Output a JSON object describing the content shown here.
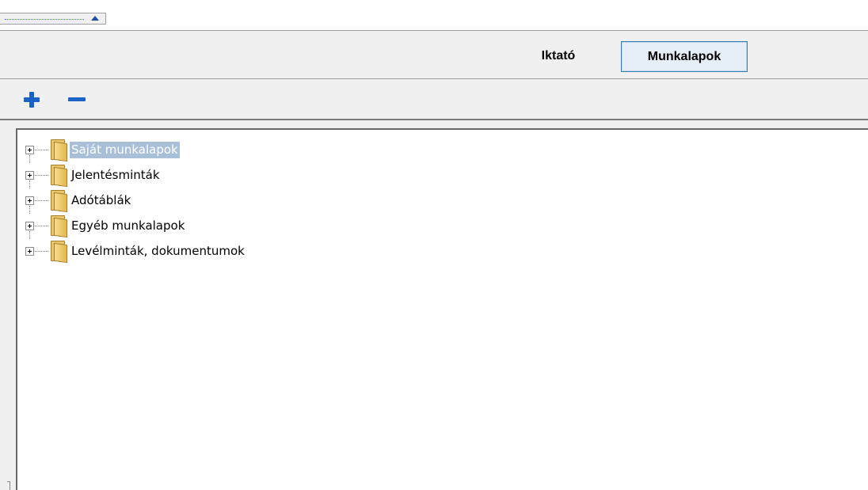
{
  "tabs": [
    {
      "label": "Iktató",
      "active": false
    },
    {
      "label": "Munkalapok",
      "active": true
    }
  ],
  "toolbar": {
    "add_icon": "plus-icon",
    "remove_icon": "minus-icon"
  },
  "tree": {
    "items": [
      {
        "label": "Saját munkalapok",
        "selected": true,
        "icon": "folder-icon"
      },
      {
        "label": "Jelentésminták",
        "selected": false,
        "icon": "folder-icon"
      },
      {
        "label": "Adótáblák",
        "selected": false,
        "icon": "folder-icon"
      },
      {
        "label": "Egyéb munkalapok",
        "selected": false,
        "icon": "folder-icon"
      },
      {
        "label": "Levélminták, dokumentumok",
        "selected": false,
        "icon": "folder-icon"
      }
    ]
  },
  "colors": {
    "accent": "#1a64c8",
    "selection": "#a9bfd8",
    "active_tab_border": "#3c7fb1"
  }
}
